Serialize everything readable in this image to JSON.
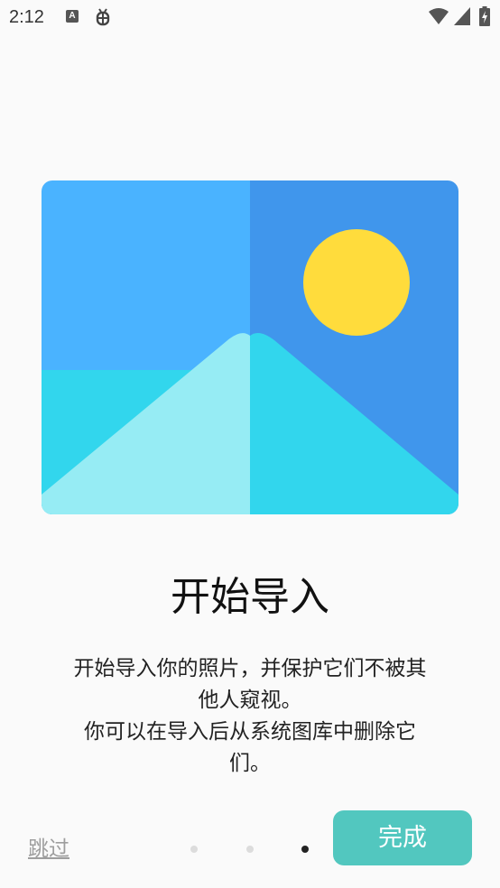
{
  "status_bar": {
    "time": "2:12",
    "notification_icons": [
      "a-icon",
      "bug-icon"
    ],
    "right_icons": [
      "wifi-icon",
      "signal-icon",
      "battery-icon"
    ]
  },
  "illustration": {
    "icon": "image-placeholder-icon",
    "colors": {
      "sky_left": "#4ab3ff",
      "sky_right": "#4096ec",
      "sun": "#ffdc3c",
      "mountain_light": "#96ecf4",
      "ground": "#32d6ed"
    }
  },
  "onboarding": {
    "title": "开始导入",
    "description_line_1": "开始导入你的照片，并保护它们不被其他人窥视。",
    "description_line_2": "你可以在导入后从系统图库中删除它们。"
  },
  "footer": {
    "skip_label": "跳过",
    "done_label": "完成",
    "page_count": 3,
    "active_page": 3
  },
  "colors": {
    "background": "#fafafa",
    "accent": "#52c7bf",
    "dot_inactive": "#dcdcdc",
    "dot_active": "#222222",
    "skip_text": "#9e9e9e"
  }
}
